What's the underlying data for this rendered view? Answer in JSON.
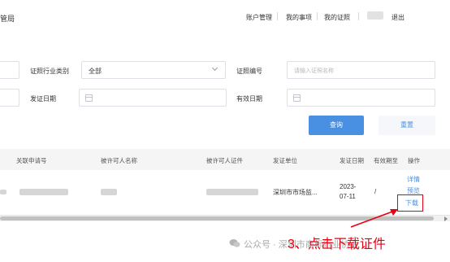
{
  "header": {
    "brand_partial": "管局",
    "nav": [
      {
        "label": "账户管理"
      },
      {
        "label": "我的事项"
      },
      {
        "label": "我的证照"
      },
      {
        "label": "退出"
      }
    ]
  },
  "filters": {
    "industry_label": "证照行业类别",
    "industry_value": "全部",
    "number_label": "证照编号",
    "number_placeholder": "请输入证照名称",
    "issue_date_label": "发证日期",
    "valid_date_label": "有效日期",
    "query_button": "查询",
    "reset_button": "重置"
  },
  "table": {
    "headers": [
      "关联申请号",
      "被许可人名称",
      "被许可人证件",
      "发证单位",
      "发证日期",
      "有效期至",
      "操作"
    ],
    "rows": [
      {
        "issuer": "深圳市市场监...",
        "issue_date_line1": "2023-",
        "issue_date_line2": "07-11",
        "valid_until": "/",
        "actions": [
          "详情",
          "预览",
          "下载"
        ]
      }
    ]
  },
  "annotation": {
    "text": "3、点击下载证件",
    "color": "#e60012"
  },
  "watermark": {
    "text": "公众号 · 深圳市商标行业协会"
  },
  "colors": {
    "primary": "#4a90e2",
    "highlight": "#e60012"
  }
}
